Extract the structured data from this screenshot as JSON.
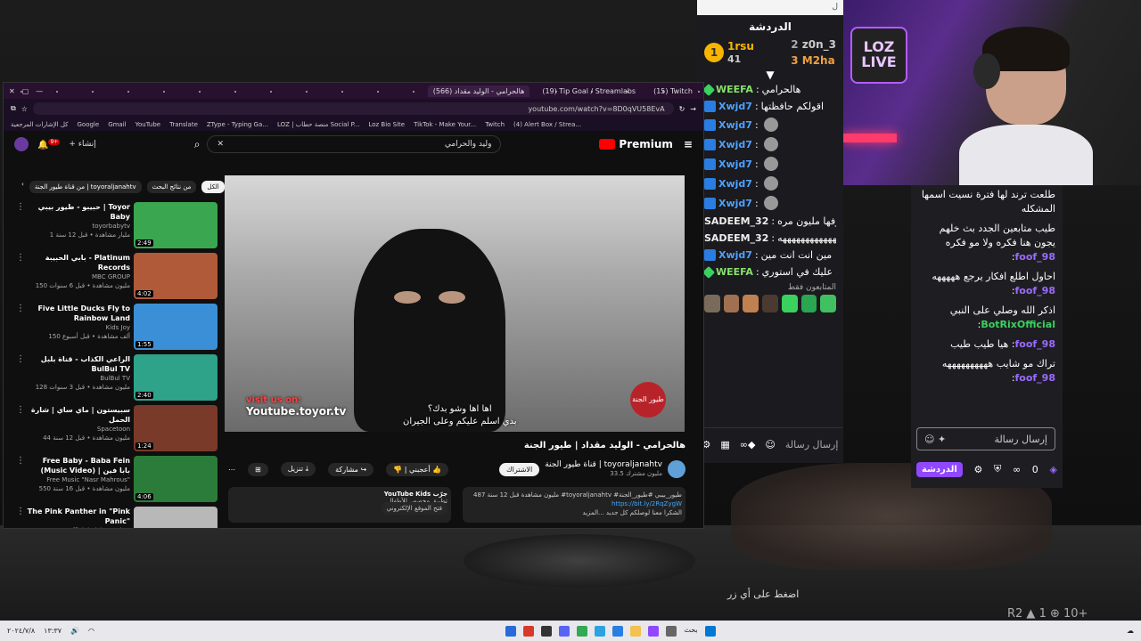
{
  "background": {
    "prompt": "اضغط على أي زر",
    "stats": "R2 ▲ 1 ⊕ 10+"
  },
  "webcam": {
    "logo_line1": "LOZ",
    "logo_line2": "LIVE"
  },
  "chat1": {
    "top_hint": "ل",
    "title": "الدردشة",
    "leaderboard": [
      {
        "rank": "1",
        "name": "1rsu",
        "score": "41"
      },
      {
        "rank": "2",
        "name": "z0n_3",
        "score": ""
      },
      {
        "rank": "3",
        "name": "M2ha",
        "score": ""
      }
    ],
    "messages": [
      {
        "user": "WEEFA",
        "text": "هالحرامي",
        "badge": "green"
      },
      {
        "user": "Xwjd7",
        "text": "اقولكم حافظتها",
        "badge": "blue"
      },
      {
        "user": "Xwjd7",
        "text": "",
        "badge": "blue"
      },
      {
        "user": "Xwjd7",
        "text": "",
        "badge": "blue"
      },
      {
        "user": "Xwjd7",
        "text": "",
        "badge": "blue"
      },
      {
        "user": "Xwjd7",
        "text": "",
        "badge": "blue"
      },
      {
        "user": "Xwjd7",
        "text": "",
        "badge": "blue"
      },
      {
        "user": "SADEEM_32",
        "text": "كنت اشوفها مليون مره",
        "badge": "none"
      },
      {
        "user": "SADEEM_32",
        "text": "ههههههههههههههههههههههه",
        "badge": "none"
      },
      {
        "user": "Xwjd7",
        "text": "مين انت انت مين",
        "badge": "blue"
      },
      {
        "user": "WEEFA",
        "text": "مذي حطيتها عليك في استوري",
        "badge": "green"
      }
    ],
    "subs_label": "المتابعون فقط",
    "input_placeholder": "إرسال رسالة"
  },
  "chat2": {
    "messages": [
      {
        "user": "",
        "text": "طلعت ترند لها فترة نسيت اسمها المشكله"
      },
      {
        "user": "foof_98",
        "text": "طيب متابعين الجدد بث خلهم يجون هنا فكره ولا مو فكره"
      },
      {
        "user": "foof_98",
        "text": "احاول اطلع افكار يرجع هههههه"
      },
      {
        "user": "BotRixOfficial",
        "text": "اذكر الله وصلي على النبي"
      },
      {
        "user": "foof_98",
        "text": "هيا طيب طيب"
      },
      {
        "user": "foof_98",
        "text": "تراك مو شايب ههههههههههه"
      }
    ],
    "input_placeholder": "إرسال رسالة",
    "chat_button": "الدردشة",
    "viewer_count": "0"
  },
  "browser": {
    "tabs": [
      {
        "label": "هالحرامي - الوليد مقداد (566)"
      },
      {
        "label": "(19) Tip Goal / Streamlabs"
      },
      {
        "label": "(15) Twitch"
      }
    ],
    "url": "youtube.com/watch?v=8D0qVU58EvA",
    "bookmarks": [
      "(4) Alert Box / Strea...",
      "Twitch",
      "TikTok - Make Your...",
      "Loz Bio Site",
      "LOZ | منصة حطاب Social P...",
      "ZType - Typing Ga...",
      "Translate",
      "YouTube",
      "Gmail",
      "Google",
      "كل الإشارات المرجعية"
    ]
  },
  "youtube": {
    "premium_label": "Premium",
    "search_value": "وليد والحرامي",
    "create_label": "إنشاء",
    "notif_count": "9+",
    "chips": [
      "الكل",
      "من نتائج البحث",
      "من قناة طيور الجنة | toyoraljanahtv"
    ],
    "video_title": "هالحرامي - الوليد مقداد | طيور الجنة",
    "channel_name": "قناة طيور الجنة | toyoraljanahtv",
    "subscribers": "33.5 مليون مشترك",
    "subscribe": "الاشتراك",
    "like": "أعجبني",
    "share": "مشاركة",
    "download": "تنزيل",
    "description": "487 مليون مشاهدة قبل 12 سنة #toyoraljanahtv #طيور_بيبي #طيور_الجنة",
    "description_link": "https://bit.ly/2RqZygW",
    "description_more": "الشكرا معنا لوصلكم كل جديد ...المزيد",
    "kids_title": "YouTube Kids جرّب",
    "kids_sub": "تطبيق مخصص للأطفال",
    "kids_button": "فتح الموقع الإلكتروني",
    "player_visit": "visit us on:",
    "player_site": "Youtube.toyor.tv",
    "player_sub1": "اها اها وشو بدك؟",
    "player_sub2": "بدي اسلم عليكم وعلى الجيران",
    "player_logo": "طيور الجنة",
    "related": [
      {
        "title": "حبيبو - طيور بيبي | Toyor Baby",
        "channel": "toyorbabytv",
        "meta": "1 مليار مشاهدة • قبل 12 سنة",
        "duration": "2:49",
        "thumb": "#3aa650"
      },
      {
        "title": "بابي الحبيبة - Platinum Records",
        "channel": "MBC GROUP",
        "meta": "150 مليون مشاهدة • قبل 6 سنوات",
        "duration": "4:02",
        "thumb": "#b05a3a"
      },
      {
        "title": "Five Little Ducks Fly to Rainbow Land",
        "channel": "Kids Joy",
        "meta": "150 ألف مشاهدة • قبل أسبوع",
        "duration": "1:55",
        "thumb": "#3b8fd6"
      },
      {
        "title": "الراعي الكذاب - قناة بلبل BulBul TV",
        "channel": "BulBul TV",
        "meta": "128 مليون مشاهدة • قبل 3 سنوات",
        "duration": "2:40",
        "thumb": "#2fa28a"
      },
      {
        "title": "سبيستون | ماي ساي | شارة الحمل",
        "channel": "Spacetoon",
        "meta": "44 مليون مشاهدة • قبل 12 سنة",
        "duration": "1:24",
        "thumb": "#7a3a2a"
      },
      {
        "title": "Free Baby - Baba Fein (Music Video) | بابا فين",
        "channel": "Free Music \"Nasr Mahrous\"",
        "meta": "550 مليون مشاهدة • قبل 16 سنة",
        "duration": "4:06",
        "thumb": "#2b7c3a"
      },
      {
        "title": "The Pink Panther in \"Pink Panic\"",
        "channel": "Official Pink Panther",
        "meta": "",
        "duration": "",
        "thumb": "#b8b8b8"
      }
    ]
  },
  "taskbar": {
    "search_label": "بحث",
    "time": "١٣:٣٧",
    "date": "٢٠٢٤/٧/٨"
  }
}
